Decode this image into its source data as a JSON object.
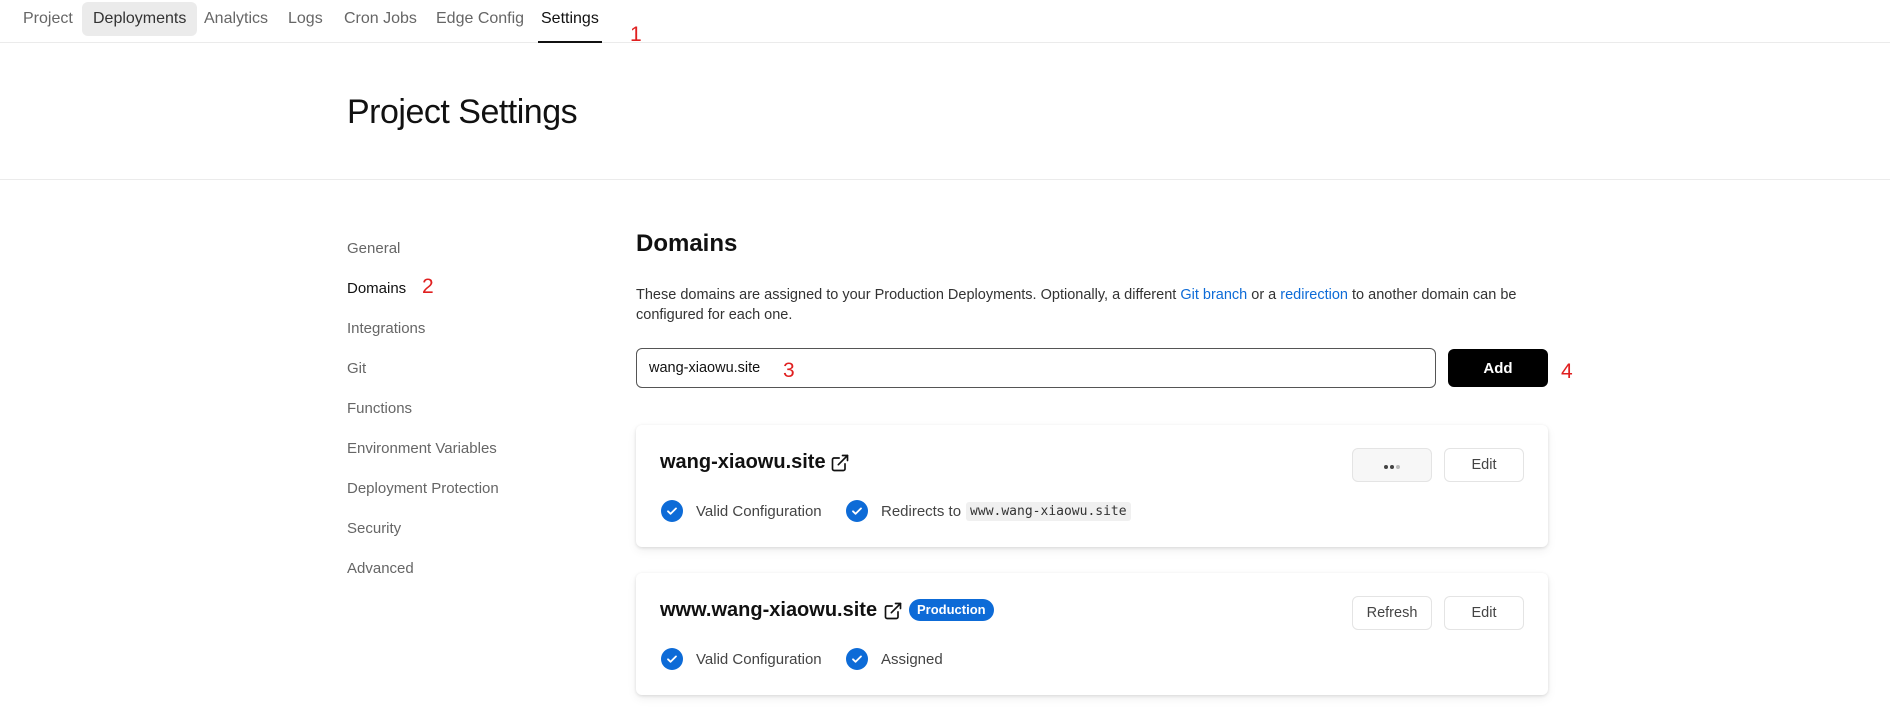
{
  "nav": {
    "tabs": [
      {
        "label": "Project"
      },
      {
        "label": "Deployments"
      },
      {
        "label": "Analytics"
      },
      {
        "label": "Logs"
      },
      {
        "label": "Cron Jobs"
      },
      {
        "label": "Edge Config"
      },
      {
        "label": "Settings"
      }
    ],
    "active": "Settings"
  },
  "annotations": [
    "1",
    "2",
    "3",
    "4"
  ],
  "page": {
    "title": "Project Settings"
  },
  "sidebar": {
    "items": [
      {
        "label": "General"
      },
      {
        "label": "Domains"
      },
      {
        "label": "Integrations"
      },
      {
        "label": "Git"
      },
      {
        "label": "Functions"
      },
      {
        "label": "Environment Variables"
      },
      {
        "label": "Deployment Protection"
      },
      {
        "label": "Security"
      },
      {
        "label": "Advanced"
      }
    ],
    "active": "Domains"
  },
  "domains": {
    "title": "Domains",
    "desc_part1": "These domains are assigned to your Production Deployments. Optionally, a different ",
    "link_git_branch": "Git branch",
    "desc_part2": " or a ",
    "link_redirection": "redirection",
    "desc_part3": " to another domain can be configured for each one.",
    "input_value": "wang-xiaowu.site",
    "add_label": "Add",
    "cards": [
      {
        "name": "wang-xiaowu.site",
        "edit_label": "Edit",
        "status1": "Valid Configuration",
        "status2": "Redirects to",
        "redirect_target": "www.wang-xiaowu.site"
      },
      {
        "name": "www.wang-xiaowu.site",
        "badge": "Production",
        "refresh_label": "Refresh",
        "edit_label": "Edit",
        "status1": "Valid Configuration",
        "status2": "Assigned"
      }
    ]
  },
  "colors": {
    "accent": "#0d6bd7",
    "annotation": "#e02020"
  }
}
